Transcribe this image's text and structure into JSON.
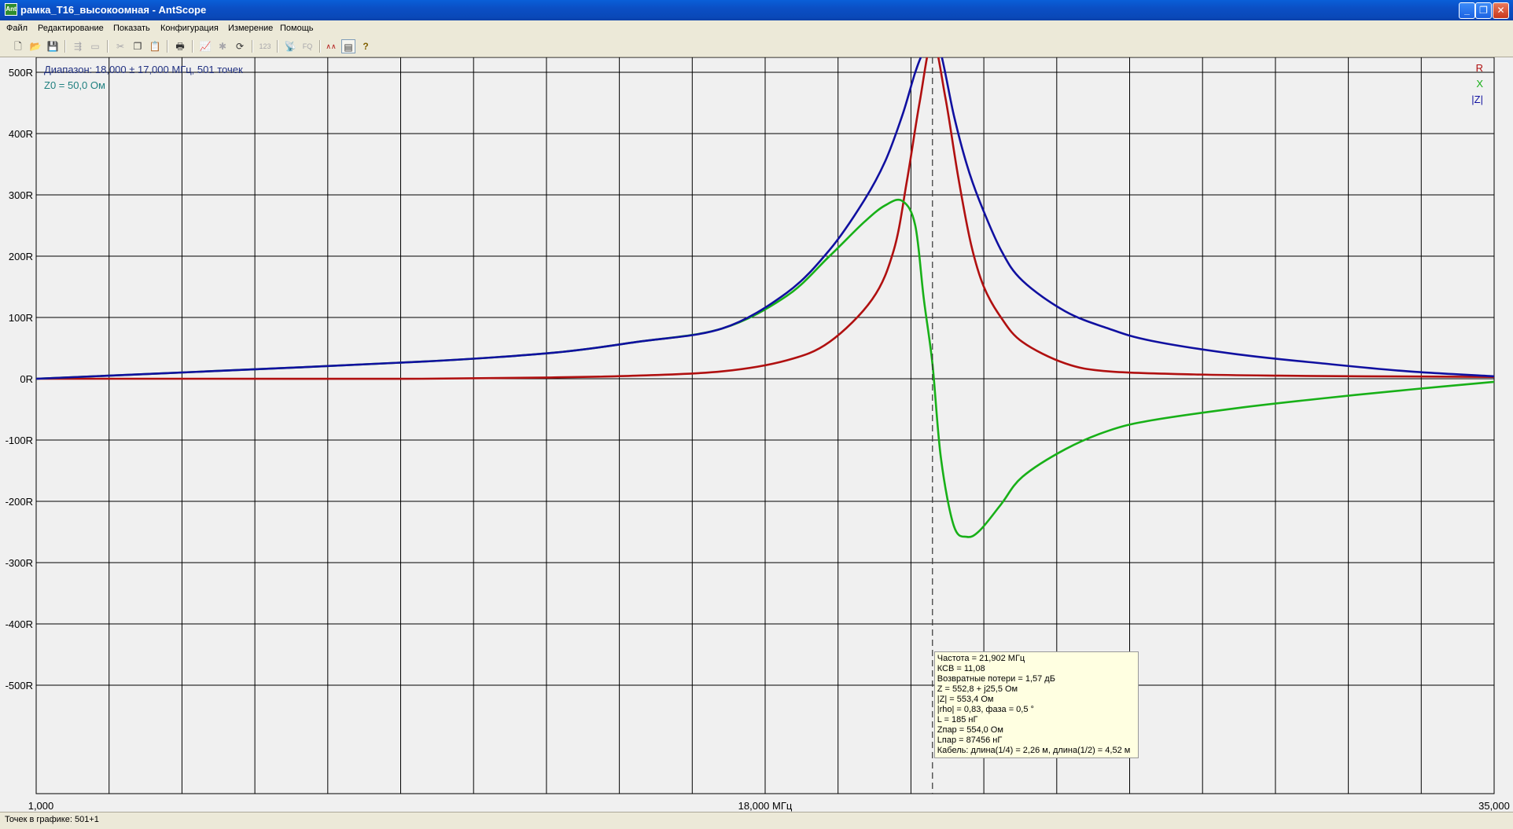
{
  "window": {
    "title": "рамка_Т16_высокоомная - AntScope",
    "icon_text": "Ant"
  },
  "menu": [
    "Файл",
    "Редактирование",
    "Показать",
    "Конфигурация",
    "Измерение",
    "Помощь"
  ],
  "toolbar_icons": [
    {
      "name": "new-file-icon",
      "glyph": "🗋",
      "enabled": true
    },
    {
      "name": "open-file-icon",
      "glyph": "📂",
      "enabled": true
    },
    {
      "name": "save-icon",
      "glyph": "💾",
      "enabled": true
    },
    {
      "name": "import-icon",
      "glyph": "⇶",
      "enabled": false
    },
    {
      "name": "export-icon",
      "glyph": "▭",
      "enabled": false
    },
    {
      "name": "cut-icon",
      "glyph": "✂",
      "enabled": false
    },
    {
      "name": "copy-icon",
      "glyph": "❐",
      "enabled": true
    },
    {
      "name": "paste-icon",
      "glyph": "📋",
      "enabled": false
    },
    {
      "name": "print-icon",
      "glyph": "🖶",
      "enabled": true
    },
    {
      "name": "chart-icon",
      "glyph": "📈",
      "enabled": false
    },
    {
      "name": "marker-icon",
      "glyph": "✱",
      "enabled": false
    },
    {
      "name": "refresh-icon",
      "glyph": "⟳",
      "enabled": true
    },
    {
      "name": "number-icon",
      "glyph": "123",
      "enabled": false
    },
    {
      "name": "antenna-icon",
      "glyph": "📡",
      "enabled": false
    },
    {
      "name": "fq-icon",
      "glyph": "FQ",
      "enabled": false
    },
    {
      "name": "waveform-icon",
      "glyph": "∧∧",
      "enabled": true
    },
    {
      "name": "table-icon",
      "glyph": "▤",
      "enabled": true
    },
    {
      "name": "help-icon",
      "glyph": "?",
      "enabled": true
    }
  ],
  "plot": {
    "range_text": "Диапазон: 18,000 ± 17,000 МГц, 501 точек",
    "z0_text": "Z0 = 50,0 Ом",
    "legend": [
      {
        "label": "R",
        "color": "#b01010"
      },
      {
        "label": "X",
        "color": "#18b018"
      },
      {
        "label": "|Z|",
        "color": "#1010a0"
      }
    ],
    "y_ticks": [
      "500R",
      "400R",
      "300R",
      "200R",
      "100R",
      "0R",
      "-100R",
      "-200R",
      "-300R",
      "-400R",
      "-500R"
    ],
    "x_ticks": [
      "1,000",
      "18,000 МГц",
      "35,000"
    ]
  },
  "chart_data": {
    "type": "line",
    "x_unit": "МГц",
    "xlim": [
      1.0,
      35.0
    ],
    "ylim": [
      -600,
      600
    ],
    "marker_frequency": 21.902,
    "series": [
      {
        "name": "R",
        "color": "#b01010",
        "x": [
          1,
          5,
          10,
          13,
          15,
          17,
          18.5,
          19.5,
          20.5,
          21.0,
          21.3,
          21.6,
          21.9,
          22.2,
          22.5,
          22.8,
          23.1,
          23.5,
          24,
          25,
          26,
          28,
          30,
          32,
          35
        ],
        "y": [
          0,
          0,
          0,
          2,
          5,
          12,
          30,
          60,
          130,
          210,
          320,
          450,
          552,
          460,
          330,
          220,
          150,
          100,
          60,
          25,
          12,
          7,
          5,
          4,
          3
        ]
      },
      {
        "name": "X",
        "color": "#18b018",
        "x": [
          1,
          5,
          10,
          13,
          15,
          17,
          18.5,
          19.5,
          20.3,
          20.8,
          21.2,
          21.5,
          21.7,
          21.9,
          22.1,
          22.4,
          22.7,
          23.0,
          23.5,
          24,
          25,
          26,
          27,
          29,
          31,
          33,
          35
        ],
        "y": [
          0,
          12,
          28,
          42,
          60,
          82,
          135,
          200,
          255,
          283,
          290,
          250,
          130,
          25,
          -130,
          -240,
          -258,
          -248,
          -205,
          -160,
          -115,
          -85,
          -68,
          -48,
          -32,
          -18,
          -5
        ]
      },
      {
        "name": "|Z|",
        "color": "#1010a0",
        "x": [
          1,
          5,
          10,
          13,
          15,
          17,
          18.5,
          19.5,
          20.3,
          20.8,
          21.2,
          21.5,
          21.7,
          21.9,
          22.1,
          22.4,
          22.7,
          23.0,
          23.5,
          24,
          25,
          26,
          27,
          29,
          31,
          33,
          35
        ],
        "y": [
          0,
          12,
          28,
          42,
          60,
          82,
          140,
          210,
          290,
          355,
          430,
          500,
          535,
          553,
          530,
          430,
          350,
          290,
          210,
          160,
          110,
          82,
          62,
          40,
          25,
          12,
          4
        ]
      }
    ]
  },
  "marker_info": {
    "lines": [
      "Частота = 21,902 МГц",
      "КСВ = 11,08",
      "Возвратные потери = 1,57 дБ",
      "Z = 552,8 + j25,5 Ом",
      "|Z| = 553,4 Ом",
      "|rho| = 0,83, фаза = 0,5 °",
      "L = 185 нГ",
      "Zпар = 554,0 Ом",
      "Lпар = 87456 нГ",
      "Кабель: длина(1/4) = 2,26 м, длина(1/2) = 4,52 м"
    ]
  },
  "status": {
    "points_text": "Точек в графике: 501+1"
  }
}
